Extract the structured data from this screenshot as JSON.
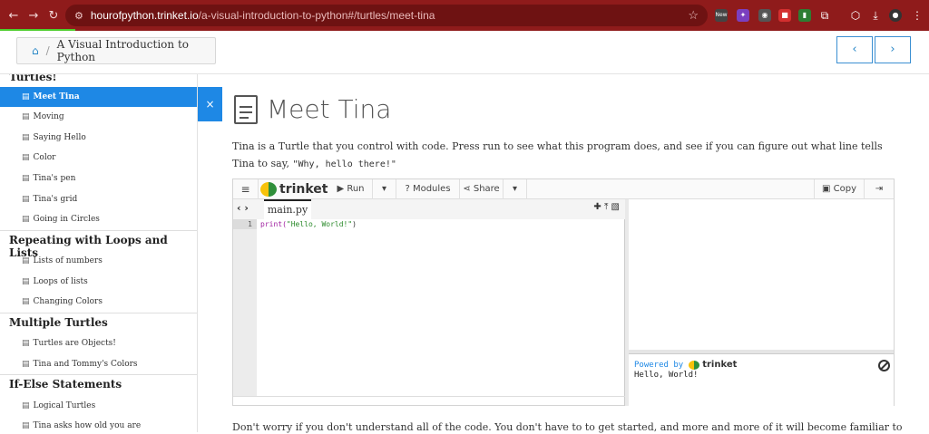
{
  "browser": {
    "url_host": "hourofpython.trinket.io",
    "url_path": "/a-visual-introduction-to-python#/turtles/meet-tina",
    "ext_new_badge": "New"
  },
  "header": {
    "breadcrumb": "A Visual Introduction to Python",
    "prev_label": "‹",
    "next_label": "›"
  },
  "sidebar": {
    "sections": [
      {
        "title": "Turtles!"
      },
      {
        "title": "Repeating with Loops and Lists"
      },
      {
        "title": "Multiple Turtles"
      },
      {
        "title": "If-Else Statements"
      }
    ],
    "items": [
      {
        "label": "Meet Tina"
      },
      {
        "label": "Moving"
      },
      {
        "label": "Saying Hello"
      },
      {
        "label": "Color"
      },
      {
        "label": "Tina's pen"
      },
      {
        "label": "Tina's grid"
      },
      {
        "label": "Going in Circles"
      },
      {
        "label": "Lists of numbers"
      },
      {
        "label": "Loops of lists"
      },
      {
        "label": "Changing Colors"
      },
      {
        "label": "Turtles are Objects!"
      },
      {
        "label": "Tina and Tommy's Colors"
      },
      {
        "label": "Logical Turtles"
      },
      {
        "label": "Tina asks how old you are"
      }
    ],
    "active_item": "Meet Tina",
    "close_label": "×"
  },
  "main": {
    "title": "Meet Tina",
    "intro_text": "Tina is a Turtle that you control with code. Press run to see what this program does, and see if you can figure out what line tells Tina to say, ",
    "intro_code": "\"Why, hello there!\"",
    "bottom_text": "Don't worry if you don't understand all of the code. You don't have to to get started, and more and more of it will become familiar to you as you keep"
  },
  "trinket": {
    "brand": "trinket",
    "run_label": "Run",
    "modules_label": "? Modules",
    "share_label": "Share",
    "copy_label": "Copy",
    "file_tab": "main.py",
    "line_number": "1",
    "code_fn": "print(",
    "code_str": "\"Hello, World!\"",
    "code_close": ")",
    "powered_by": "Powered by",
    "output": "Hello, World!"
  },
  "colors": {
    "chrome": "#8f1b1b",
    "accent": "#1e88e5",
    "progress": "#4ccc2b"
  }
}
